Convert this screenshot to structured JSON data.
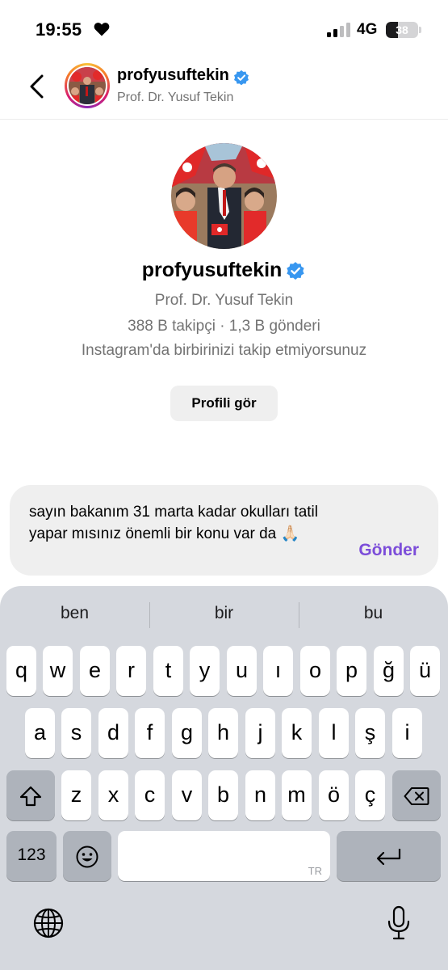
{
  "status_bar": {
    "time": "19:55",
    "network": "4G",
    "battery": "38",
    "battery_level": 0.38
  },
  "header": {
    "username": "profyusuftekin",
    "full_name": "Prof. Dr. Yusuf Tekin"
  },
  "profile": {
    "username": "profyusuftekin",
    "full_name": "Prof. Dr. Yusuf Tekin",
    "stats": "388 B takipçi · 1,3 B gönderi",
    "follow_note": "Instagram'da birbirinizi takip etmiyorsunuz",
    "view_profile_label": "Profili gör"
  },
  "composer": {
    "text": "sayın bakanım 31 marta kadar okulları tatil yapar mısınız önemli bir konu var da 🙏🏻",
    "send_label": "Gönder"
  },
  "keyboard": {
    "suggestions": [
      "ben",
      "bir",
      "bu"
    ],
    "row1": [
      "q",
      "w",
      "e",
      "r",
      "t",
      "y",
      "u",
      "ı",
      "o",
      "p",
      "ğ",
      "ü"
    ],
    "row2": [
      "a",
      "s",
      "d",
      "f",
      "g",
      "h",
      "j",
      "k",
      "l",
      "ş",
      "i"
    ],
    "row3": [
      "z",
      "x",
      "c",
      "v",
      "b",
      "n",
      "m",
      "ö",
      "ç"
    ],
    "numbers_label": "123",
    "space_language": "TR"
  },
  "colors": {
    "accent": "#7c4dd9",
    "verified": "#3897f0"
  }
}
